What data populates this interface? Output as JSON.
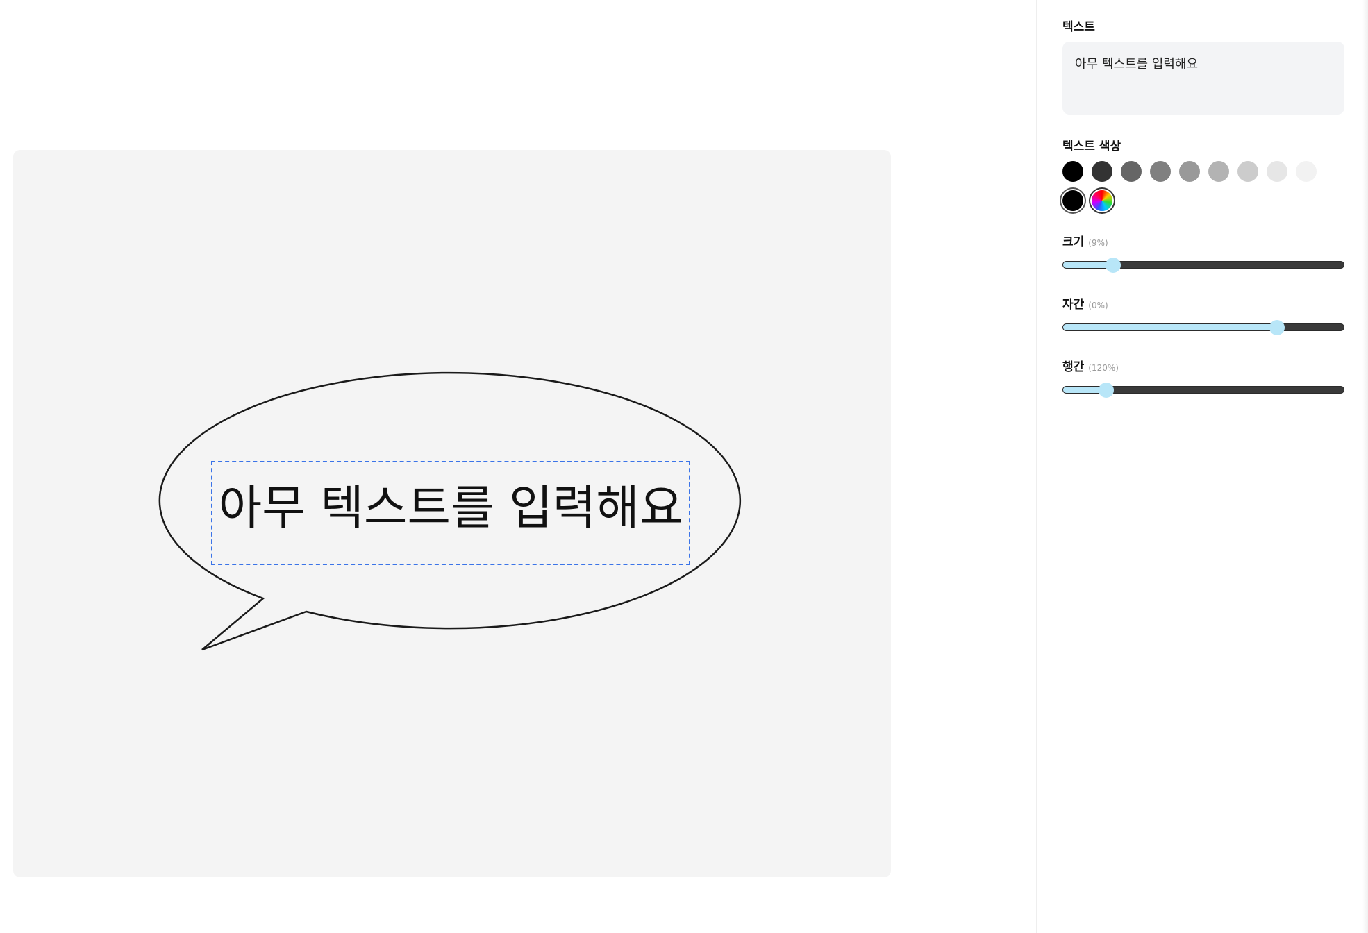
{
  "canvas": {
    "bubble_text": "아무 텍스트를 입력해요"
  },
  "panel": {
    "text_section": {
      "label": "텍스트",
      "value": "아무 텍스트를 입력해요"
    },
    "color_section": {
      "label": "텍스트 색상",
      "swatches": [
        "#000000",
        "#333333",
        "#666666",
        "#808080",
        "#999999",
        "#b3b3b3",
        "#cccccc",
        "#e6e6e6",
        "#f2f2f2"
      ],
      "selected_color": "#000000",
      "custom_picker_icon": "rainbow-color-wheel"
    },
    "size_slider": {
      "label": "크기",
      "value_text": "(9%)",
      "value": 0.18
    },
    "letter_spacing_slider": {
      "label": "자간",
      "value_text": "(0%)",
      "value": 0.76
    },
    "line_height_slider": {
      "label": "행간",
      "value_text": "(120%)",
      "value": 0.155
    }
  }
}
